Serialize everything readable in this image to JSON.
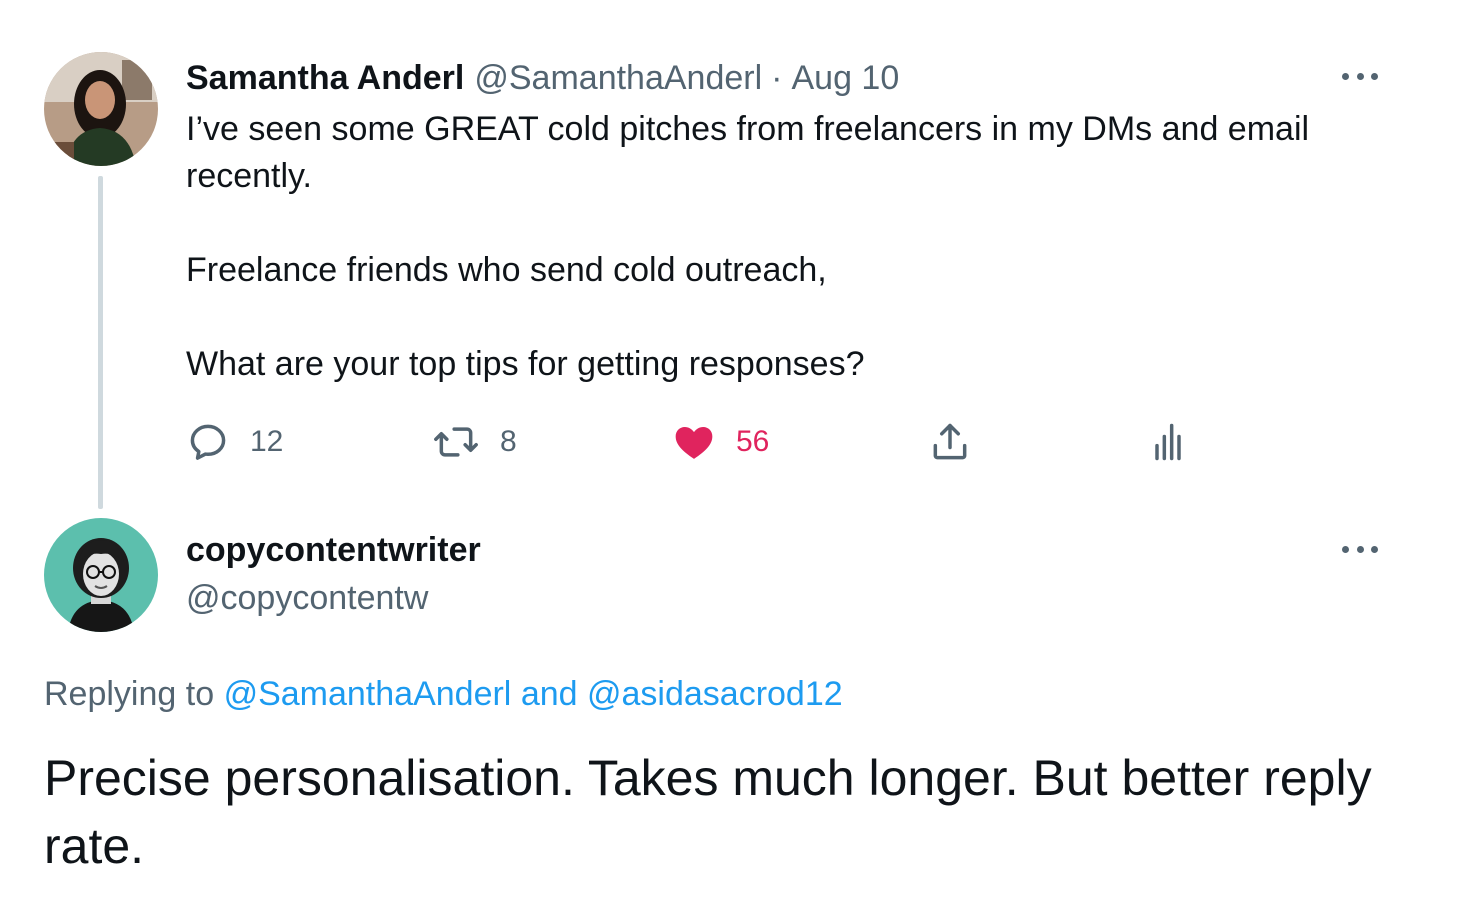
{
  "parent_tweet": {
    "display_name": "Samantha Anderl",
    "handle": "@SamanthaAnderl",
    "separator": "·",
    "date": "Aug 10",
    "text_paragraphs": [
      "I’ve seen some GREAT cold pitches from freelancers in my DMs and email recently.",
      "Freelance friends who send cold outreach,",
      "What are your top tips for getting responses?"
    ],
    "reply_count": "12",
    "retweet_count": "8",
    "like_count": "56",
    "icons": [
      "reply-icon",
      "retweet-icon",
      "like-icon",
      "share-icon",
      "analytics-icon",
      "more-icon"
    ]
  },
  "reply_tweet": {
    "display_name": "copycontentwriter",
    "handle": "@copycontentw",
    "replying_prefix": "Replying to",
    "replying_mention_1": "@SamanthaAnderl",
    "replying_and": "and",
    "replying_mention_2": "@asidasacrod12",
    "text": "Precise personalisation. Takes much longer. But better reply rate."
  },
  "colors": {
    "text_primary": "#0f1419",
    "text_secondary": "#536471",
    "link": "#1d9bf0",
    "like_active": "#e0245e",
    "thread_line": "#cfd9de"
  }
}
